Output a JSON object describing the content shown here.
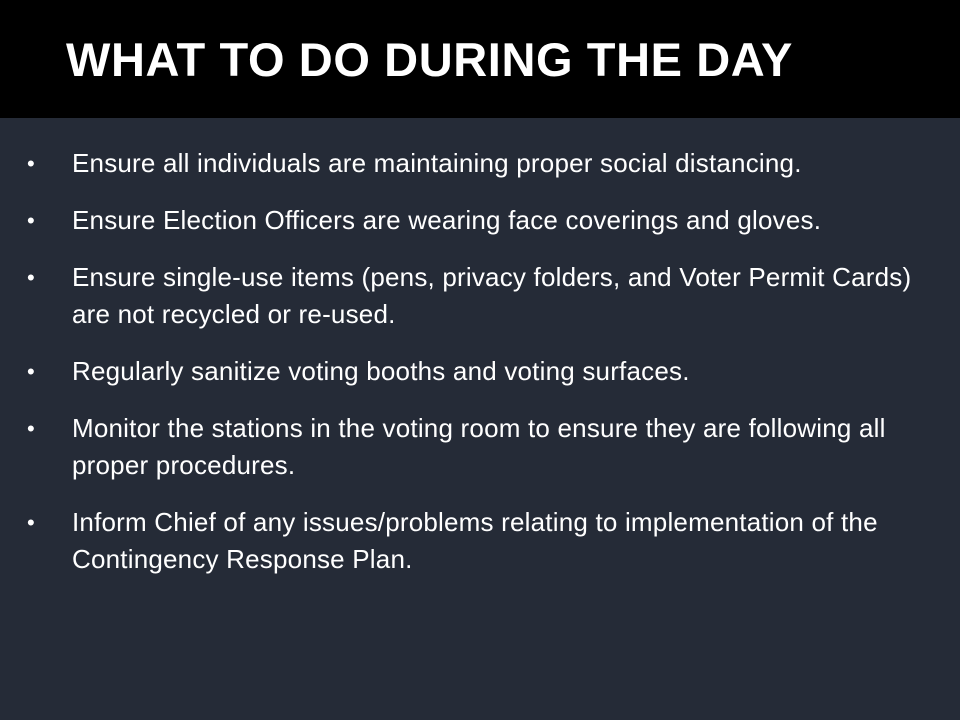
{
  "slide": {
    "title": "WHAT TO DO DURING THE DAY",
    "bullet_glyph": "•",
    "bullets": [
      "Ensure all individuals are maintaining proper social distancing.",
      "Ensure Election Officers are wearing face coverings and gloves.",
      "Ensure single-use items (pens, privacy folders, and Voter Permit Cards) are not recycled or re-used.",
      "Regularly sanitize voting booths and voting surfaces.",
      "Monitor the stations in the voting room to ensure they are following all proper procedures.",
      "Inform Chief of any issues/problems relating to implementation of the Contingency Response Plan."
    ]
  },
  "colors": {
    "title_bar_bg": "#000000",
    "body_bg": "#252b37",
    "text": "#ffffff"
  }
}
